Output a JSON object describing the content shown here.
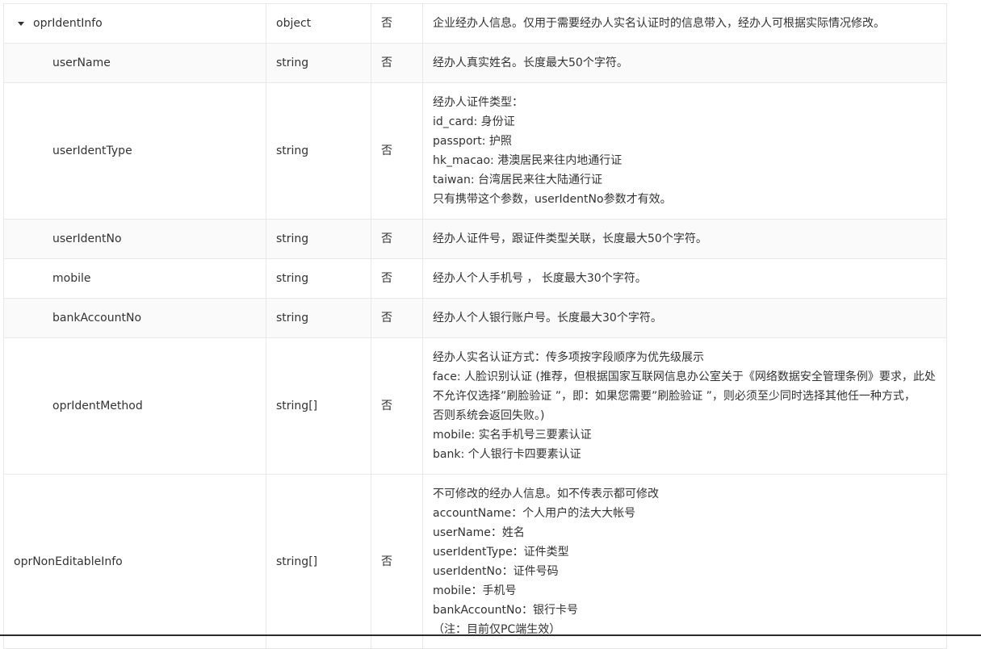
{
  "rows": [
    {
      "name": "oprIdentInfo",
      "type": "object",
      "required": "否",
      "description": [
        "企业经办人信息。仅用于需要经办人实名认证时的信息带入，经办人可根据实际情况修改。"
      ]
    },
    {
      "name": "userName",
      "type": "string",
      "required": "否",
      "description": [
        "经办人真实姓名。长度最大50个字符。"
      ]
    },
    {
      "name": "userIdentType",
      "type": "string",
      "required": "否",
      "description": [
        "经办人证件类型：",
        "id_card: 身份证",
        "passport: 护照",
        "hk_macao: 港澳居民来往内地通行证",
        "taiwan: 台湾居民来往大陆通行证",
        "只有携带这个参数，userIdentNo参数才有效。"
      ]
    },
    {
      "name": "userIdentNo",
      "type": "string",
      "required": "否",
      "description": [
        "经办人证件号，跟证件类型关联，长度最大50个字符。"
      ]
    },
    {
      "name": "mobile",
      "type": "string",
      "required": "否",
      "description": [
        "经办人个人手机号 ， 长度最大30个字符。"
      ]
    },
    {
      "name": "bankAccountNo",
      "type": "string",
      "required": "否",
      "description": [
        "经办人个人银行账户号。长度最大30个字符。"
      ]
    },
    {
      "name": "oprIdentMethod",
      "type": "string[]",
      "required": "否",
      "description": [
        "经办人实名认证方式：传多项按字段顺序为优先级展示",
        "face: 人脸识别认证 (推荐，但根据国家互联网信息办公室关于《网络数据安全管理条例》要求，此处",
        "不允许仅选择”刷脸验证 ”，即：如果您需要”刷脸验证 ”，则必须至少同时选择其他任一种方式，",
        "否则系统会返回失败。)",
        "mobile: 实名手机号三要素认证",
        "bank: 个人银行卡四要素认证"
      ]
    },
    {
      "name": "oprNonEditableInfo",
      "type": "string[]",
      "required": "否",
      "description": [
        "不可修改的经办人信息。如不传表示都可修改",
        "accountName：个人用户的法大大帐号",
        "userName：姓名",
        "userIdentType：证件类型",
        "userIdentNo：证件号码",
        "mobile：手机号",
        "bankAccountNo：银行卡号",
        "（注：目前仅PC端生效）"
      ]
    }
  ]
}
